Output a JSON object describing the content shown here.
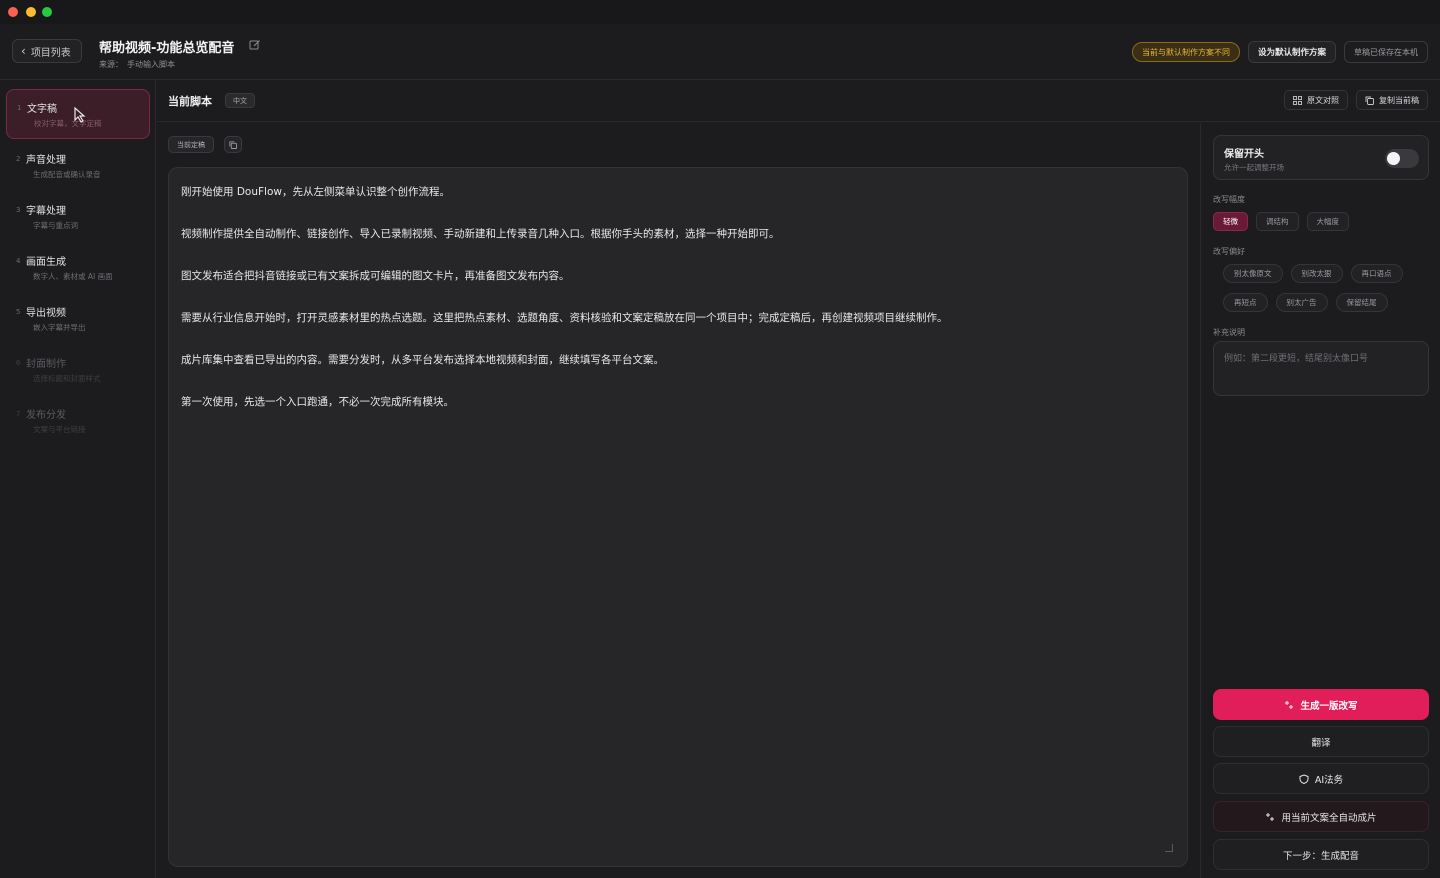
{
  "header": {
    "back_label": "项目列表",
    "project_title": "帮助视频-功能总览配音",
    "source_label": "来源：",
    "source_value": "手动输入脚本",
    "warning_badge": "当前与默认制作方案不同",
    "set_default_label": "设为默认制作方案",
    "saved_status": "草稿已保存在本机"
  },
  "sidebar": {
    "items": [
      {
        "num": "1",
        "label": "文字稿",
        "sub": "校对字幕，文字定稿"
      },
      {
        "num": "2",
        "label": "声音处理",
        "sub": "生成配音或确认录音"
      },
      {
        "num": "3",
        "label": "字幕处理",
        "sub": "字幕与重点词"
      },
      {
        "num": "4",
        "label": "画面生成",
        "sub": "数字人、素材或 AI 画面"
      },
      {
        "num": "5",
        "label": "导出视频",
        "sub": "嵌入字幕并导出"
      },
      {
        "num": "6",
        "label": "封面制作",
        "sub": "选择标题和封面样式"
      },
      {
        "num": "7",
        "label": "发布分发",
        "sub": "文案与平台链接"
      }
    ]
  },
  "main": {
    "title": "当前脚本",
    "lang_tag": "中文",
    "compare_label": "原文对照",
    "copy_label": "复制当前稿",
    "draft_tag": "当前定稿",
    "paragraphs": [
      "刚开始使用 DouFlow，先从左侧菜单认识整个创作流程。",
      "视频制作提供全自动制作、链接创作、导入已录制视频、手动新建和上传录音几种入口。根据你手头的素材，选择一种开始即可。",
      "图文发布适合把抖音链接或已有文案拆成可编辑的图文卡片，再准备图文发布内容。",
      "需要从行业信息开始时，打开灵感素材里的热点选题。这里把热点素材、选题角度、资料核验和文案定稿放在同一个项目中；完成定稿后，再创建视频项目继续制作。",
      "成片库集中查看已导出的内容。需要分发时，从多平台发布选择本地视频和封面，继续填写各平台文案。",
      "第一次使用，先选一个入口跑通，不必一次完成所有模块。"
    ]
  },
  "panel": {
    "keep_title": "保留开头",
    "keep_sub": "允许一起调整开场",
    "keep_enabled": false,
    "amplitude_label": "改写幅度",
    "amplitude_options": [
      "轻微",
      "调结构",
      "大幅度"
    ],
    "amplitude_selected": "轻微",
    "preference_label": "改写偏好",
    "preference_row1": [
      "别太像原文",
      "别改太狠",
      "再口语点"
    ],
    "preference_row2": [
      "再短点",
      "别太广告",
      "保留结尾"
    ],
    "note_label": "补充说明",
    "note_placeholder": "例如：第二段更短，结尾别太像口号",
    "generate_label": "生成一版改写",
    "translate_label": "翻译",
    "legal_label": "AI法务",
    "auto_label": "用当前文案全自动成片",
    "next_label": "下一步：生成配音"
  },
  "colors": {
    "accent": "#e11d5a",
    "warning": "#e9b640",
    "background": "#1c1c1e"
  }
}
